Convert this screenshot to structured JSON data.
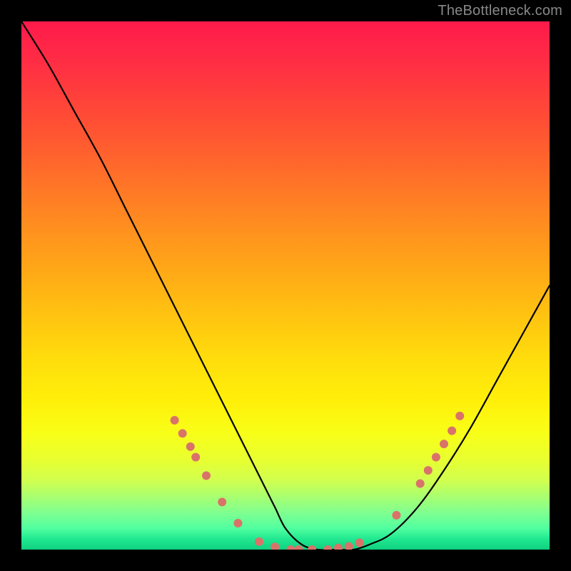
{
  "watermark": "TheBottleneck.com",
  "chart_data": {
    "type": "line",
    "title": "",
    "xlabel": "",
    "ylabel": "",
    "xlim": [
      0,
      100
    ],
    "ylim": [
      0,
      100
    ],
    "background": {
      "type": "vertical-gradient",
      "stops": [
        {
          "pos": 0,
          "color": "#ff1a4b"
        },
        {
          "pos": 50,
          "color": "#ffb010"
        },
        {
          "pos": 80,
          "color": "#f8ff18"
        },
        {
          "pos": 100,
          "color": "#10d080"
        }
      ]
    },
    "series": [
      {
        "name": "bottleneck-curve",
        "color": "#000000",
        "x": [
          0,
          5,
          10,
          15,
          20,
          25,
          30,
          35,
          40,
          45,
          48,
          50,
          53,
          56,
          60,
          63,
          66,
          70,
          75,
          80,
          85,
          90,
          95,
          100
        ],
        "y": [
          100,
          92,
          83,
          74,
          64,
          54,
          44,
          34,
          24,
          14,
          8,
          4,
          1,
          0,
          0,
          0,
          1,
          3,
          8,
          15,
          23,
          32,
          41,
          50
        ]
      }
    ],
    "markers": {
      "name": "highlight-dots",
      "color": "#d9736a",
      "radius": 6,
      "points": [
        {
          "x": 29,
          "y": 24.5
        },
        {
          "x": 30.5,
          "y": 22
        },
        {
          "x": 32,
          "y": 19.5
        },
        {
          "x": 33,
          "y": 17.5
        },
        {
          "x": 35,
          "y": 14
        },
        {
          "x": 38,
          "y": 9
        },
        {
          "x": 41,
          "y": 5
        },
        {
          "x": 45,
          "y": 1.5
        },
        {
          "x": 48,
          "y": 0.5
        },
        {
          "x": 51,
          "y": 0
        },
        {
          "x": 52.5,
          "y": 0
        },
        {
          "x": 55,
          "y": 0
        },
        {
          "x": 58,
          "y": 0
        },
        {
          "x": 60,
          "y": 0.3
        },
        {
          "x": 62,
          "y": 0.6
        },
        {
          "x": 64,
          "y": 1.3
        },
        {
          "x": 71,
          "y": 6.5
        },
        {
          "x": 75.5,
          "y": 12.5
        },
        {
          "x": 77,
          "y": 15
        },
        {
          "x": 78.5,
          "y": 17.5
        },
        {
          "x": 80,
          "y": 20
        },
        {
          "x": 81.5,
          "y": 22.5
        },
        {
          "x": 83,
          "y": 25.3
        }
      ]
    }
  }
}
